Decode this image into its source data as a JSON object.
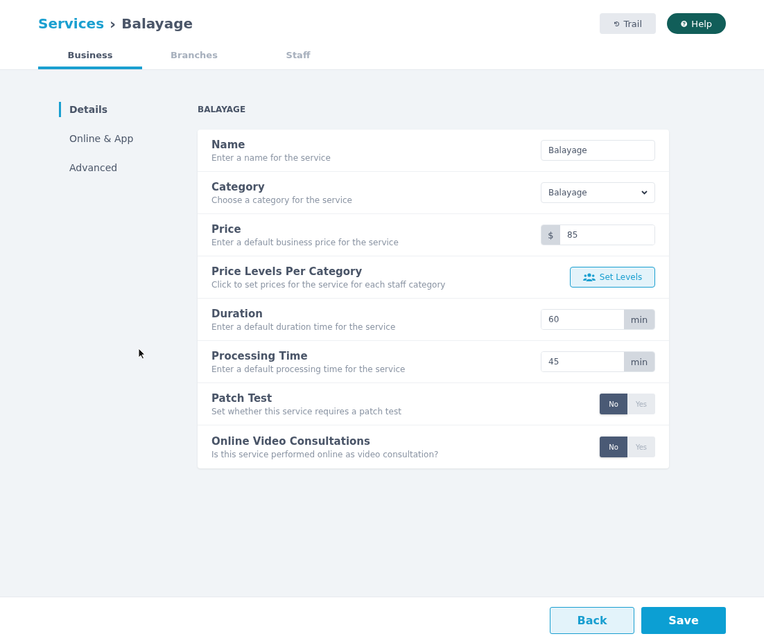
{
  "breadcrumb": {
    "parent": "Services",
    "separator": "›",
    "current": "Balayage"
  },
  "header_buttons": [
    {
      "kind": "trail",
      "label": "Trail"
    },
    {
      "kind": "help",
      "label": "Help"
    }
  ],
  "tabs": [
    {
      "label": "Business",
      "selected": true
    },
    {
      "label": "Branches",
      "selected": false
    },
    {
      "label": "Staff",
      "selected": false
    }
  ],
  "sidebar": {
    "items": [
      {
        "label": "Details",
        "selected": true
      },
      {
        "label": "Online & App",
        "selected": false
      },
      {
        "label": "Advanced",
        "selected": false
      }
    ]
  },
  "section_title": "BALAYAGE",
  "rows": [
    {
      "kind": "text",
      "label": "Name",
      "description": "Enter a name for the service",
      "value": "Balayage"
    },
    {
      "kind": "select",
      "label": "Category",
      "description": "Choose a category for the service",
      "value": "Balayage"
    },
    {
      "kind": "prefix",
      "label": "Price",
      "description": "Enter a default business price for the service",
      "prefix": "$",
      "value": "85"
    },
    {
      "kind": "button",
      "label": "Price Levels Per Category",
      "description": "Click to set prices for the service for each staff category",
      "button": "Set Levels"
    },
    {
      "kind": "suffix",
      "label": "Duration",
      "description": "Enter a default duration time for the service",
      "value": "60",
      "suffix": "min"
    },
    {
      "kind": "suffix",
      "label": "Processing Time",
      "description": "Enter a default processing time for the service",
      "value": "45",
      "suffix": "min"
    },
    {
      "kind": "toggle",
      "label": "Patch Test",
      "description": "Set whether this service requires a patch test",
      "options": [
        {
          "label": "No",
          "selected": true
        },
        {
          "label": "Yes",
          "selected": false
        }
      ]
    },
    {
      "kind": "toggle",
      "label": "Online Video Consultations",
      "description": "Is this service performed online as video consultation?",
      "options": [
        {
          "label": "No",
          "selected": true
        },
        {
          "label": "Yes",
          "selected": false
        }
      ]
    }
  ],
  "footer_buttons": [
    {
      "kind": "secondary",
      "label": "Back"
    },
    {
      "kind": "primary",
      "label": "Save"
    }
  ]
}
